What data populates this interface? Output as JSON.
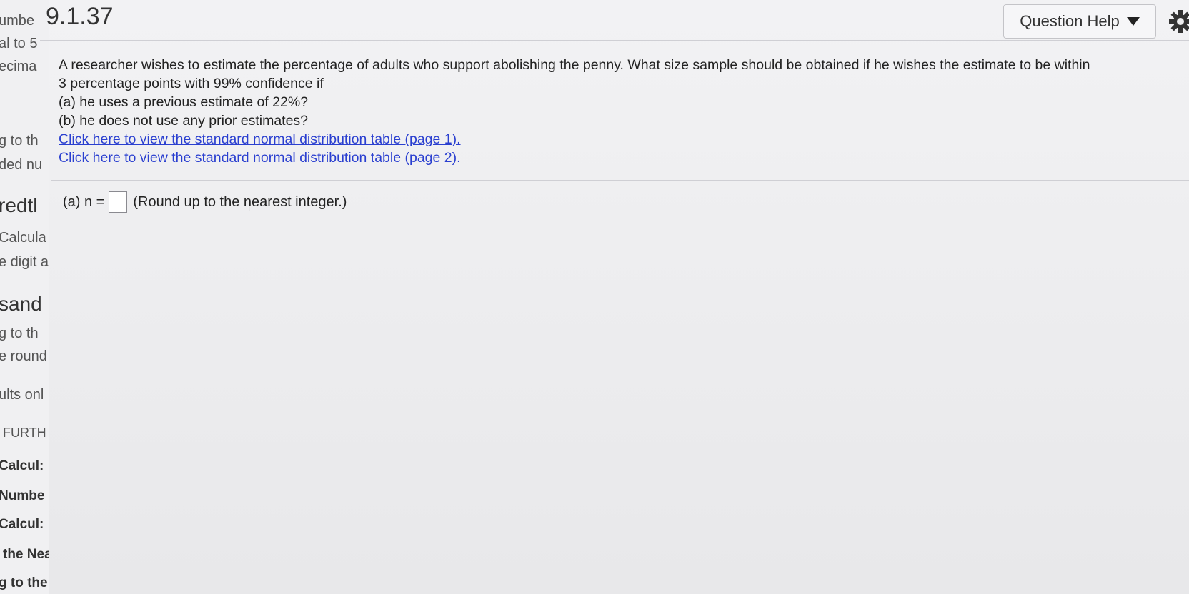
{
  "header": {
    "question_number": "9.1.37",
    "help_label": "Question Help",
    "settings_icon": "gear-icon"
  },
  "sidebar": {
    "items": [
      "umbe",
      "al to 5",
      "ecima",
      "g to th",
      "ded nu",
      "redtl",
      "Calcula",
      "e digit a",
      "sand",
      "g to th",
      "e round",
      "ults onl",
      "FURTH",
      "Calcul:",
      "Numbe",
      "Calcul:",
      "the Nea",
      "g to the"
    ]
  },
  "question": {
    "line1": "A researcher wishes to estimate the percentage of adults who support abolishing the penny. What size sample should be obtained if he wishes the estimate to be within",
    "line2": "3 percentage points with 99% confidence if",
    "part_a": "(a) he uses a previous estimate of 22%?",
    "part_b": "(b) he does not use any prior estimates?",
    "link1": "Click here to view the standard normal distribution table (page 1).",
    "link2": "Click here to view the standard normal distribution table (page 2)."
  },
  "answer": {
    "label": "(a) n =",
    "value": "",
    "hint": "(Round up to the nearest integer.)"
  },
  "colors": {
    "link": "#2a3fd0",
    "background": "#eeeef0"
  }
}
